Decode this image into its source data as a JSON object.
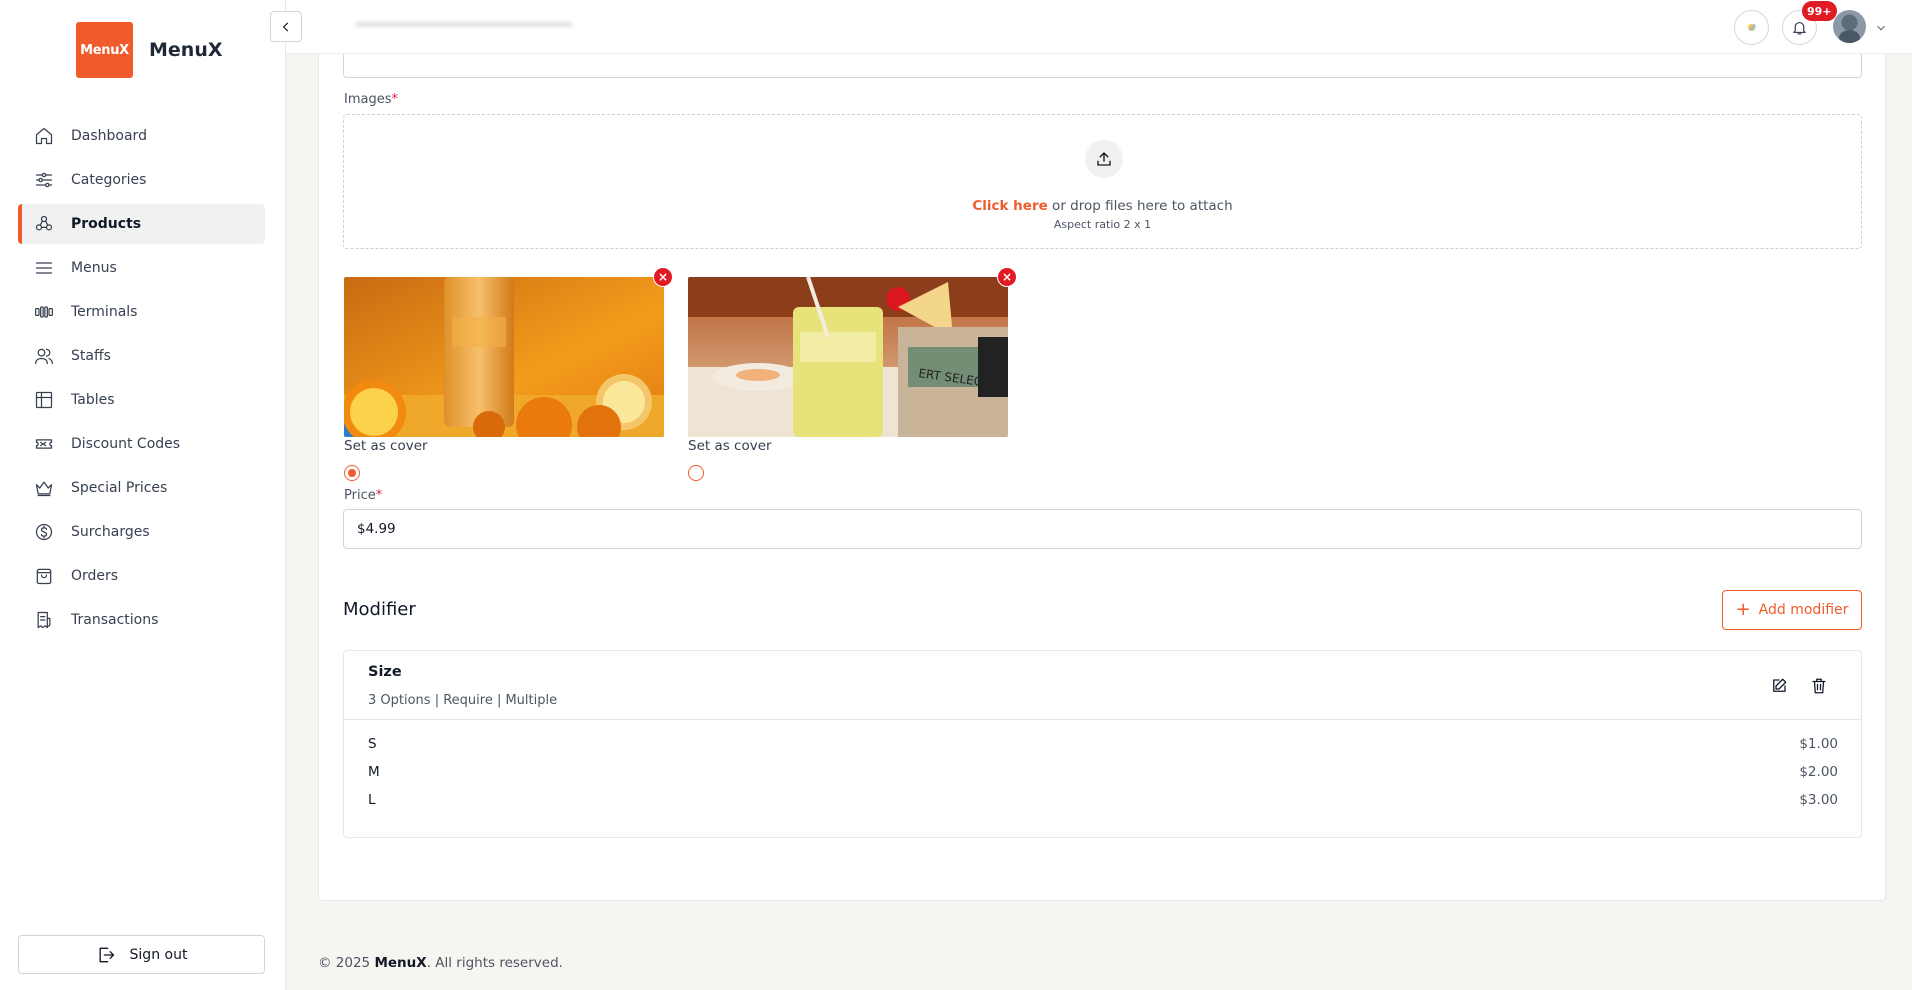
{
  "brand": {
    "logo_text": "MenuX",
    "name": "MenuX",
    "accent": "#ef5b2b"
  },
  "sidebar": {
    "items": [
      {
        "label": "Dashboard",
        "icon": "home-icon"
      },
      {
        "label": "Categories",
        "icon": "sliders-icon"
      },
      {
        "label": "Products",
        "icon": "products-icon",
        "active": true
      },
      {
        "label": "Menus",
        "icon": "menu-icon"
      },
      {
        "label": "Terminals",
        "icon": "terminal-icon"
      },
      {
        "label": "Staffs",
        "icon": "users-icon"
      },
      {
        "label": "Tables",
        "icon": "table-icon"
      },
      {
        "label": "Discount Codes",
        "icon": "ticket-icon"
      },
      {
        "label": "Special Prices",
        "icon": "crown-icon"
      },
      {
        "label": "Surcharges",
        "icon": "dollar-icon"
      },
      {
        "label": "Orders",
        "icon": "bag-icon"
      },
      {
        "label": "Transactions",
        "icon": "receipt-icon"
      }
    ],
    "signout_label": "Sign out"
  },
  "topbar": {
    "notification_count": "99+"
  },
  "form": {
    "images_label": "Images",
    "required_mark": "*",
    "dropzone": {
      "click_text": "Click here",
      "rest_text": " or drop files here to attach",
      "hint": "Aspect ratio 2 x 1"
    },
    "images": [
      {
        "cover_label": "Set as cover",
        "is_cover": true,
        "remove": "×"
      },
      {
        "cover_label": "Set as cover",
        "is_cover": false,
        "remove": "×"
      }
    ],
    "price_label": "Price",
    "price_value": "$4.99"
  },
  "modifier": {
    "title": "Modifier",
    "add_label": "Add modifier",
    "group": {
      "name": "Size",
      "summary": "3 Options | Require | Multiple",
      "options": [
        {
          "name": "S",
          "price": "$1.00"
        },
        {
          "name": "M",
          "price": "$2.00"
        },
        {
          "name": "L",
          "price": "$3.00"
        }
      ]
    }
  },
  "footer": {
    "prefix": "© 2025 ",
    "brand": "MenuX",
    "suffix": ". All rights reserved."
  }
}
